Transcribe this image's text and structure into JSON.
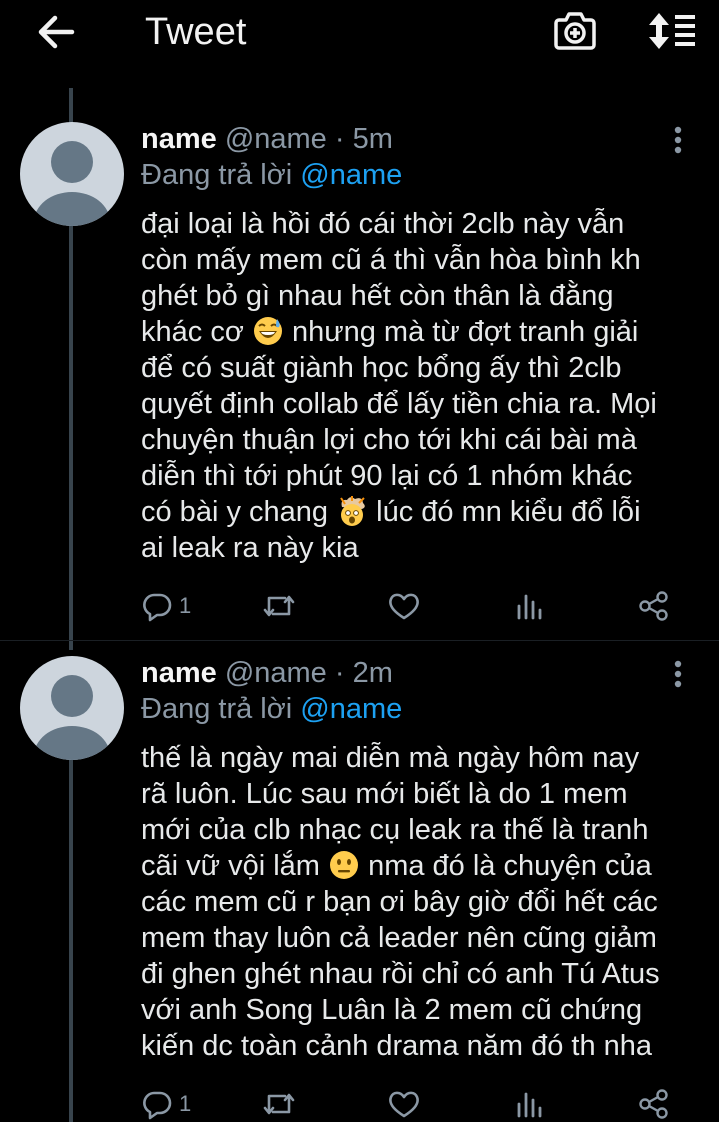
{
  "header": {
    "title": "Tweet",
    "back_icon": "arrow-left-icon",
    "camera_icon": "camera-plus-icon",
    "sort_icon": "sort-list-icon"
  },
  "colors": {
    "background": "#000000",
    "accent": "#1da1f2",
    "muted": "#8b98a5",
    "text": "#e7e9ea",
    "thread_line": "#38444d"
  },
  "tweets": [
    {
      "name": "name",
      "handle": "@name",
      "separator": "·",
      "time": "5m",
      "replying_label": "Đang trả lời",
      "replying_to": "@name",
      "text_parts": [
        "đại loại là hồi đó cái thời 2clb này vẫn\ncòn mấy mem cũ á thì vẫn hòa bình kh\nghét bỏ gì nhau hết còn thân là đằng\nkhác cơ ",
        " nhưng mà từ đợt tranh giải\nđể có suất giành học bổng ấy thì 2clb\nquyết định collab để lấy tiền chia ra. Mọi\nchuyện thuận lợi cho tới khi cái bài mà\ndiễn thì tới phút 90 lại có 1 nhóm khác\ncó bài y chang ",
        " lúc đó mn kiểu đổ lỗi\nai leak ra này kia"
      ],
      "emojis": [
        "grinning-sweat-emoji",
        "exploding-head-emoji"
      ],
      "reply_count": "1"
    },
    {
      "name": "name",
      "handle": "@name",
      "separator": "·",
      "time": "2m",
      "replying_label": "Đang trả lời",
      "replying_to": "@name",
      "text_parts": [
        "thế là ngày mai diễn mà ngày hôm nay\nrã luôn. Lúc sau mới biết là do 1 mem\nmới của clb nhạc cụ leak ra thế là tranh\ncãi vữ vội lắm ",
        " nma đó là chuyện của\ncác mem cũ r bạn ơi bây giờ đổi hết các\nmem thay luôn cả leader nên cũng giảm\nđi ghen ghét nhau rồi chỉ có anh Tú Atus\nvới anh Song Luân là 2 mem cũ chứng\nkiến dc toàn cảnh drama năm đó th nha"
      ],
      "emojis": [
        "neutral-face-emoji"
      ],
      "reply_count": "1"
    }
  ]
}
